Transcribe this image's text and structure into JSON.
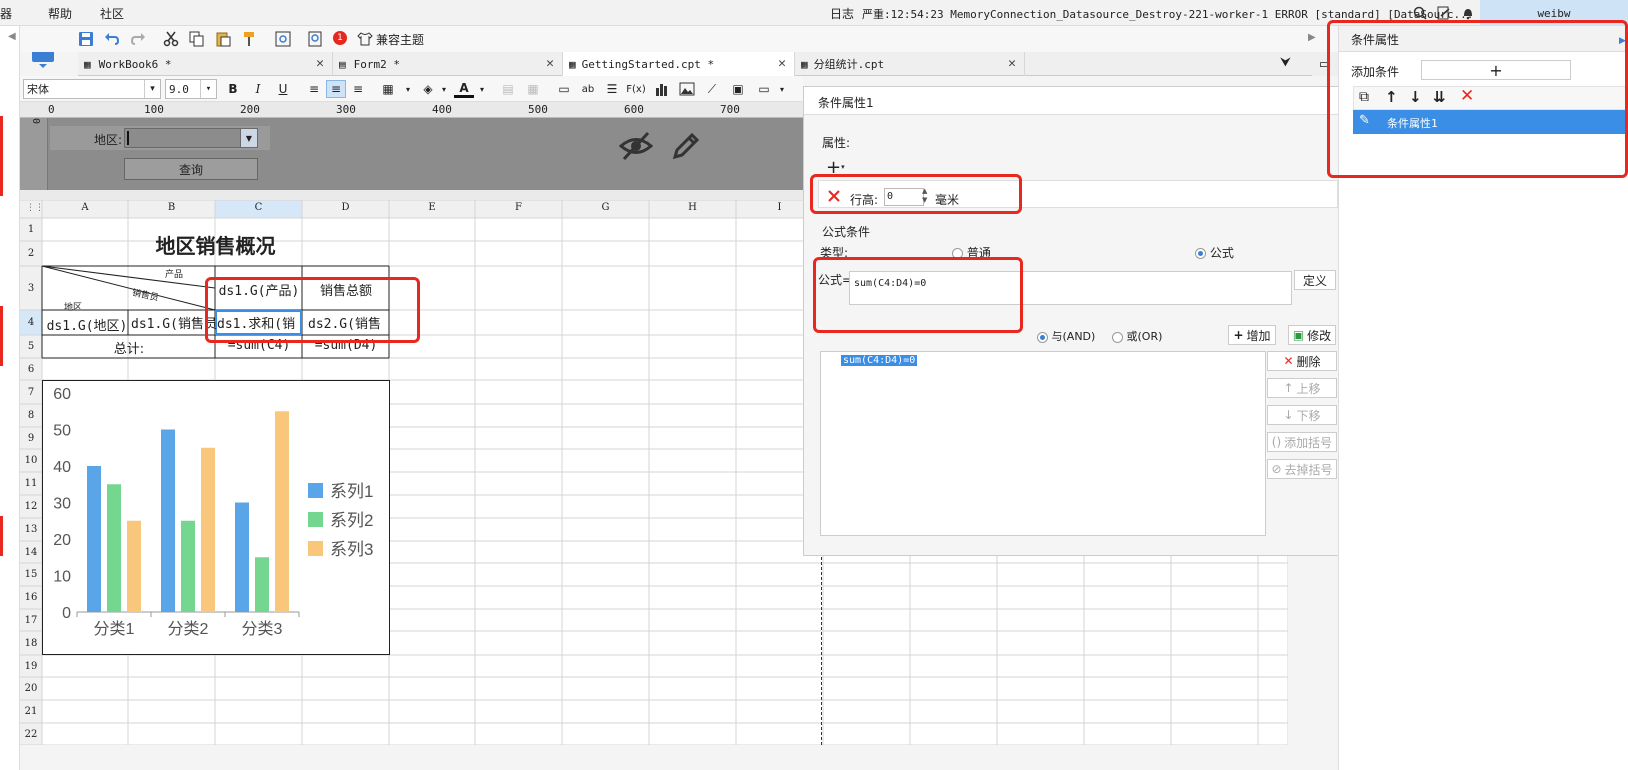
{
  "menubar": {
    "items": [
      "器",
      "帮助",
      "社区"
    ],
    "log_label": "日志",
    "severity": "严重:",
    "status_text": "12:54:23 MemoryConnection_Datasource_Destroy-221-worker-1 ERROR [standard] [DataSourc...",
    "user": "weibw",
    "notification_count": "1"
  },
  "toolbar": {
    "theme_label": "兼容主题"
  },
  "tabs": [
    {
      "label": "WorkBook6 *"
    },
    {
      "label": "Form2 *"
    },
    {
      "label": "GettingStarted.cpt *"
    },
    {
      "label": "分组统计.cpt"
    }
  ],
  "format": {
    "font": "宋体",
    "size": "9.0",
    "bold": "B",
    "italic": "I",
    "underline": "U"
  },
  "ruler": {
    "ticks": [
      "0",
      "100",
      "200",
      "300",
      "400",
      "500",
      "600",
      "700"
    ],
    "v_tick": "0"
  },
  "params": {
    "region_label": "地区:",
    "query_button": "查询"
  },
  "sheet": {
    "columns": [
      "A",
      "B",
      "C",
      "D",
      "E",
      "F",
      "G",
      "H",
      "I"
    ],
    "rows": [
      "1",
      "2",
      "3",
      "4",
      "5",
      "6",
      "7",
      "8",
      "9",
      "10",
      "11",
      "12",
      "13",
      "14",
      "15",
      "16",
      "17",
      "18",
      "19",
      "20",
      "21",
      "22"
    ],
    "title": "地区销售概况",
    "header_product": "产品",
    "header_salesperson": "销售员",
    "header_region": "地区",
    "c3": "ds1.G(产品)",
    "d3": "销售总额",
    "a4": "ds1.G(地区)",
    "b4": "ds1.G(销售员)",
    "c4": "ds1.求和(销",
    "d4": "ds2.G(销售",
    "a5": "总计:",
    "c5": "=sum(C4)",
    "d5": "=sum(D4)"
  },
  "chart_data": {
    "type": "bar",
    "categories": [
      "分类1",
      "分类2",
      "分类3"
    ],
    "series": [
      {
        "name": "系列1",
        "values": [
          40,
          50,
          30
        ],
        "color": "#5aa5e8"
      },
      {
        "name": "系列2",
        "values": [
          35,
          25,
          15
        ],
        "color": "#74d68f"
      },
      {
        "name": "系列3",
        "values": [
          25,
          45,
          55
        ],
        "color": "#f8c77b"
      }
    ],
    "yticks": [
      "0",
      "10",
      "20",
      "30",
      "40",
      "50",
      "60"
    ],
    "ylim": [
      0,
      60
    ],
    "legend": "right"
  },
  "dialog": {
    "title": "条件属性1",
    "attr_label": "属性:",
    "row_height_label": "行高:",
    "row_height_value": "0",
    "unit": "毫米",
    "formula_condition_label": "公式条件",
    "type_label": "类型:",
    "type_normal": "普通",
    "type_formula": "公式",
    "formula_label": "公式=",
    "formula_value": "sum(C4:D4)=0",
    "define_button": "定义",
    "and_label": "与(AND)",
    "or_label": "或(OR)",
    "add_button": "增加",
    "modify_button": "修改",
    "conditions": [
      "sum(C4:D4)=0"
    ],
    "delete_button": "删除",
    "up_button": "上移",
    "down_button": "下移",
    "add_bracket_button": "添加括号",
    "remove_bracket_button": "去掉括号"
  },
  "panel": {
    "title": "条件属性",
    "add_condition_label": "添加条件",
    "items": [
      "条件属性1"
    ]
  },
  "colors": {
    "accent": "#3a7fd4",
    "selected": "#3a8ee6",
    "highlight": "#e8281e"
  }
}
